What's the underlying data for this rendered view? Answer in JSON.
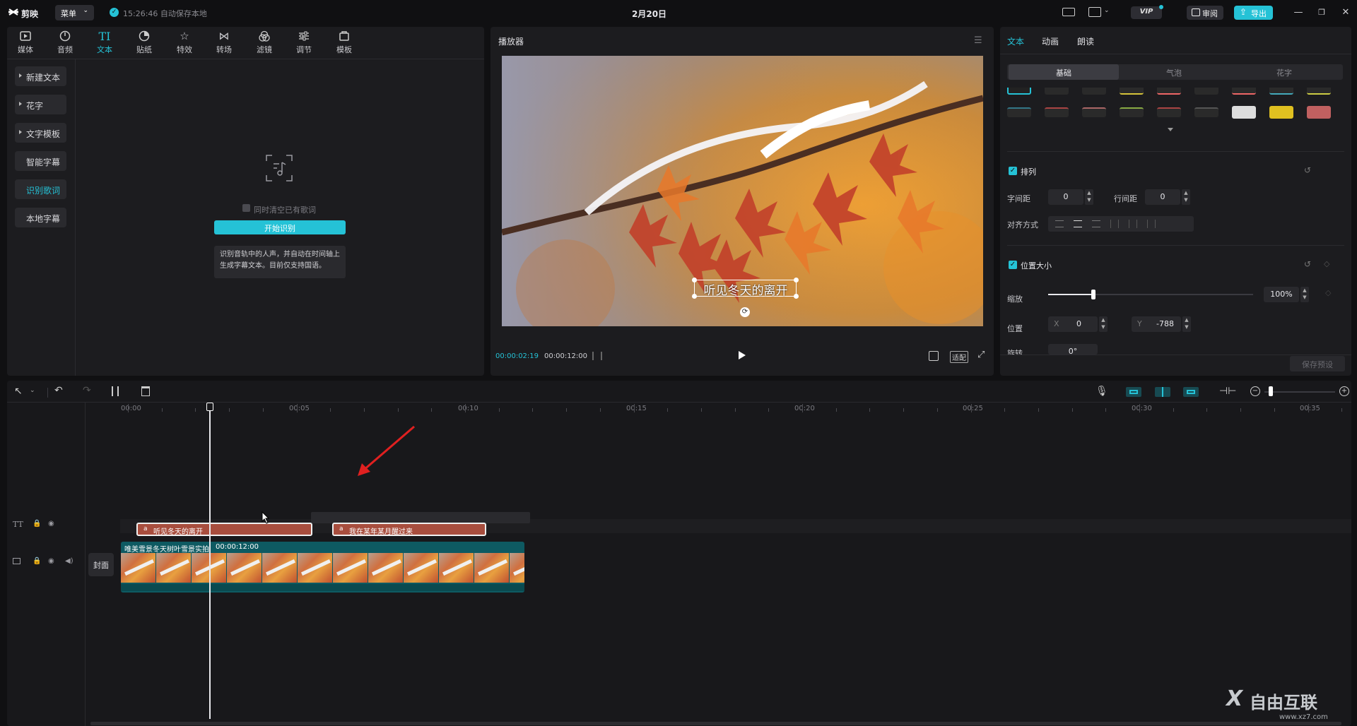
{
  "app": {
    "logo_text": "剪映",
    "menu_label": "菜单",
    "autosave": "15:26:46 自动保存本地",
    "title": "2月20日",
    "vip": "VIP",
    "review": "审阅",
    "export": "导出"
  },
  "left": {
    "tools": [
      {
        "label": "媒体",
        "icon": "media-icon"
      },
      {
        "label": "音频",
        "icon": "audio-icon"
      },
      {
        "label": "文本",
        "icon": "text-icon"
      },
      {
        "label": "贴纸",
        "icon": "sticker-icon"
      },
      {
        "label": "特效",
        "icon": "effects-icon"
      },
      {
        "label": "转场",
        "icon": "transition-icon"
      },
      {
        "label": "滤镜",
        "icon": "filter-icon"
      },
      {
        "label": "调节",
        "icon": "adjust-icon"
      },
      {
        "label": "模板",
        "icon": "template-icon"
      }
    ],
    "nav": [
      "新建文本",
      "花字",
      "文字模板",
      "智能字幕",
      "识别歌词",
      "本地字幕"
    ],
    "clear_checkbox": "同时清空已有歌词",
    "start_button": "开始识别",
    "tip": "识别音轨中的人声，并自动在时间轴上生成字幕文本。目前仅支持国语。"
  },
  "player": {
    "title": "播放器",
    "caption": "听见冬天的离开",
    "current_time": "00:00:02:19",
    "total_time": "00:00:12:00",
    "fit_label": "适配"
  },
  "right": {
    "tabs": [
      "文本",
      "动画",
      "朗读"
    ],
    "segments": [
      "基础",
      "气泡",
      "花字"
    ],
    "arrange": {
      "title": "排列",
      "char_spacing_label": "字间距",
      "char_spacing": "0",
      "line_spacing_label": "行间距",
      "line_spacing": "0",
      "align_label": "对齐方式"
    },
    "position": {
      "title": "位置大小",
      "scale_label": "缩放",
      "scale_value": "100%",
      "scale_fraction": 0.22,
      "pos_label": "位置",
      "x_label": "X",
      "x_value": "0",
      "y_label": "Y",
      "y_value": "-788",
      "rotate_label": "旋转",
      "rotate_value": "0°"
    },
    "save_preset": "保存预设"
  },
  "timeline": {
    "ticks": [
      "00:00",
      "00:05",
      "00:10",
      "00:15",
      "00:20",
      "00:25",
      "00:30",
      "00:35"
    ],
    "text_clips": [
      "听见冬天的离开",
      "我在某年某月醒过来"
    ],
    "video_clip_name": "唯美雪景冬天树叶雪景实拍",
    "video_clip_duration": "00:00:12:00",
    "cover_label": "封面",
    "watermark": "自由互联",
    "watermark_url": "www.xz7.com"
  }
}
